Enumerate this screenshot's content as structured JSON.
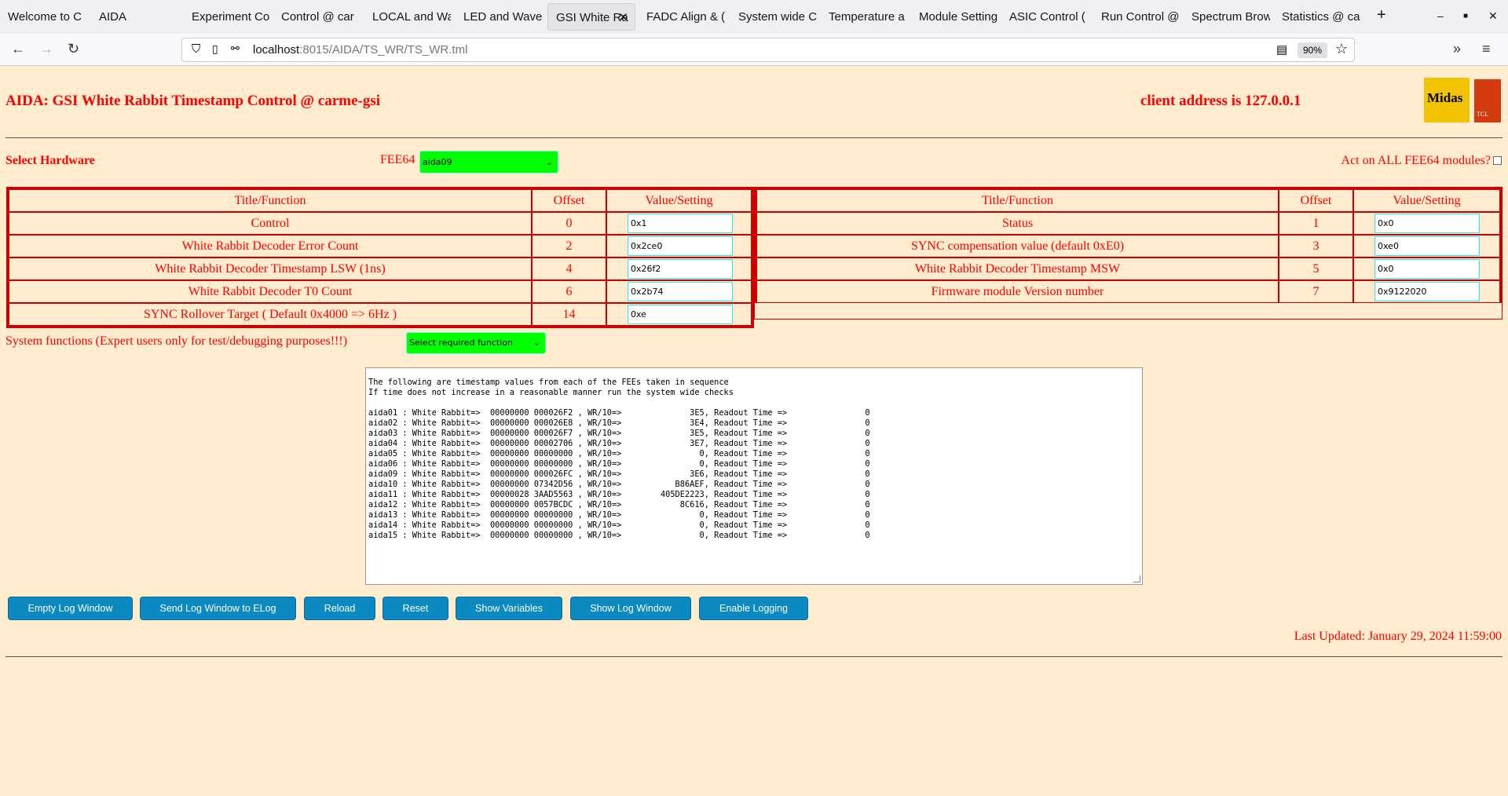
{
  "browser": {
    "tabs": [
      "Welcome to C",
      "AIDA",
      "Experiment Co",
      "Control @ car",
      "LOCAL and Wa",
      "LED and Wave",
      "GSI White Ra",
      "FADC Align & (",
      "System wide C",
      "Temperature a",
      "Module Setting",
      "ASIC Control (",
      "Run Control @",
      "Spectrum Brow",
      "Statistics @ ca"
    ],
    "active_tab": 6,
    "url_host": "localhost",
    "url_path": ":8015/AIDA/TS_WR/TS_WR.tml",
    "zoom": "90%"
  },
  "header": {
    "title": "AIDA: GSI White Rabbit Timestamp Control @ carme-gsi",
    "client": "client address is 127.0.0.1",
    "logo_midas": "Midas",
    "logo_tcl": "TCL POWERED"
  },
  "hardware": {
    "label": "Select Hardware",
    "fee_label": "FEE64",
    "fee_value": "aida09",
    "act_all": "Act on ALL FEE64 modules?"
  },
  "table": {
    "headers": [
      "Title/Function",
      "Offset",
      "Value/Setting"
    ],
    "left": [
      {
        "title": "Control",
        "offset": "0",
        "value": "0x1"
      },
      {
        "title": "White Rabbit Decoder Error Count",
        "offset": "2",
        "value": "0x2ce0"
      },
      {
        "title": "White Rabbit Decoder Timestamp LSW (1ns)",
        "offset": "4",
        "value": "0x26f2"
      },
      {
        "title": "White Rabbit Decoder T0 Count",
        "offset": "6",
        "value": "0x2b74"
      },
      {
        "title": "SYNC Rollover Target ( Default 0x4000 => 6Hz )",
        "offset": "14",
        "value": "0xe"
      }
    ],
    "right": [
      {
        "title": "Status",
        "offset": "1",
        "value": "0x0"
      },
      {
        "title": "SYNC compensation value (default 0xE0)",
        "offset": "3",
        "value": "0xe0"
      },
      {
        "title": "White Rabbit Decoder Timestamp MSW",
        "offset": "5",
        "value": "0x0"
      },
      {
        "title": "Firmware module Version number",
        "offset": "7",
        "value": "0x9122020"
      }
    ]
  },
  "system": {
    "label": "System functions (Expert users only for test/debugging purposes!!!)",
    "select": "Select required function"
  },
  "log": "The following are timestamp values from each of the FEEs taken in sequence\nIf time does not increase in a reasonable manner run the system wide checks\n\naida01 : White Rabbit=>  00000000 000026F2 , WR/10=>              3E5, Readout Time =>                0\naida02 : White Rabbit=>  00000000 000026E8 , WR/10=>              3E4, Readout Time =>                0\naida03 : White Rabbit=>  00000000 000026F7 , WR/10=>              3E5, Readout Time =>                0\naida04 : White Rabbit=>  00000000 00002706 , WR/10=>              3E7, Readout Time =>                0\naida05 : White Rabbit=>  00000000 00000000 , WR/10=>                0, Readout Time =>                0\naida06 : White Rabbit=>  00000000 00000000 , WR/10=>                0, Readout Time =>                0\naida09 : White Rabbit=>  00000000 000026FC , WR/10=>              3E6, Readout Time =>                0\naida10 : White Rabbit=>  00000000 07342D56 , WR/10=>           B86AEF, Readout Time =>                0\naida11 : White Rabbit=>  00000028 3AAD5563 , WR/10=>        405DE2223, Readout Time =>                0\naida12 : White Rabbit=>  00000000 0057BCDC , WR/10=>            8C616, Readout Time =>                0\naida13 : White Rabbit=>  00000000 00000000 , WR/10=>                0, Readout Time =>                0\naida14 : White Rabbit=>  00000000 00000000 , WR/10=>                0, Readout Time =>                0\naida15 : White Rabbit=>  00000000 00000000 , WR/10=>                0, Readout Time =>                0",
  "buttons": [
    "Empty Log Window",
    "Send Log Window to ELog",
    "Reload",
    "Reset",
    "Show Variables",
    "Show Log Window",
    "Enable Logging"
  ],
  "last_updated": "Last Updated: January 29, 2024 11:59:00",
  "colors": {
    "background": "#ffebcd",
    "text": "#ff0000",
    "select": "#00ff00",
    "button": "#0a8ac0"
  }
}
